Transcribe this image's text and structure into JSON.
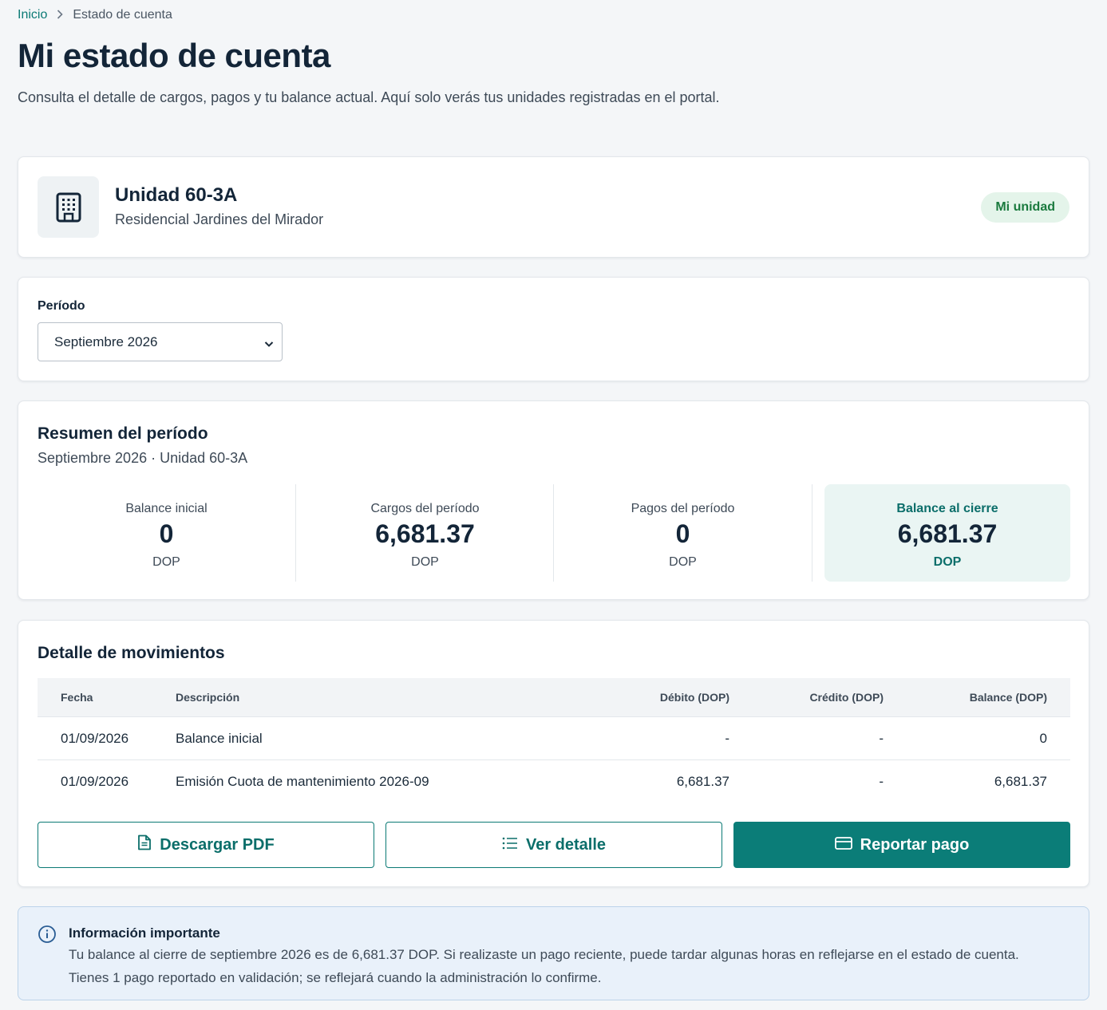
{
  "breadcrumb": {
    "home": "Inicio",
    "current": "Estado de cuenta"
  },
  "header": {
    "title": "Mi estado de cuenta",
    "subtitle": "Consulta el detalle de cargos, pagos y tu balance actual. Aquí solo verás tus unidades registradas en el portal."
  },
  "unit": {
    "icon": "building-icon",
    "name": "Unidad 60-3A",
    "residence": "Residencial Jardines del Mirador",
    "badge": "Mi unidad"
  },
  "period": {
    "label": "Período",
    "selected": "Septiembre 2026"
  },
  "summary": {
    "title": "Resumen del período",
    "subtitle": "Septiembre 2026 · Unidad 60-3A",
    "stats": [
      {
        "label": "Balance inicial",
        "value": "0",
        "unit": "DOP"
      },
      {
        "label": "Cargos del período",
        "value": "6,681.37",
        "unit": "DOP"
      },
      {
        "label": "Pagos del período",
        "value": "0",
        "unit": "DOP"
      },
      {
        "label": "Balance al cierre",
        "value": "6,681.37",
        "unit": "DOP"
      }
    ]
  },
  "movements": {
    "title": "Detalle de movimientos",
    "columns": [
      "Fecha",
      "Descripción",
      "Débito (DOP)",
      "Crédito (DOP)",
      "Balance (DOP)"
    ],
    "rows": [
      {
        "fecha": "01/09/2026",
        "descripcion": "Balance inicial",
        "debito": "-",
        "credito": "-",
        "balance": "0"
      },
      {
        "fecha": "01/09/2026",
        "descripcion": "Emisión Cuota de mantenimiento 2026-09",
        "debito": "6,681.37",
        "credito": "-",
        "balance": "6,681.37"
      }
    ]
  },
  "actions": {
    "download": "Descargar PDF",
    "detail": "Ver detalle",
    "report": "Reportar pago"
  },
  "info": {
    "title": "Información importante",
    "line1": "Tu balance al cierre de septiembre 2026 es de 6,681.37 DOP. Si realizaste un pago reciente, puede tardar algunas horas en reflejarse en el estado de cuenta.",
    "line2": "Tienes 1 pago reportado en validación; se reflejará cuando la administración lo confirme."
  },
  "colors": {
    "accent": "#0b7d78",
    "badge_bg": "#e4f4ea",
    "badge_text": "#1a7a3e",
    "info_bg": "#e9f1fa"
  }
}
